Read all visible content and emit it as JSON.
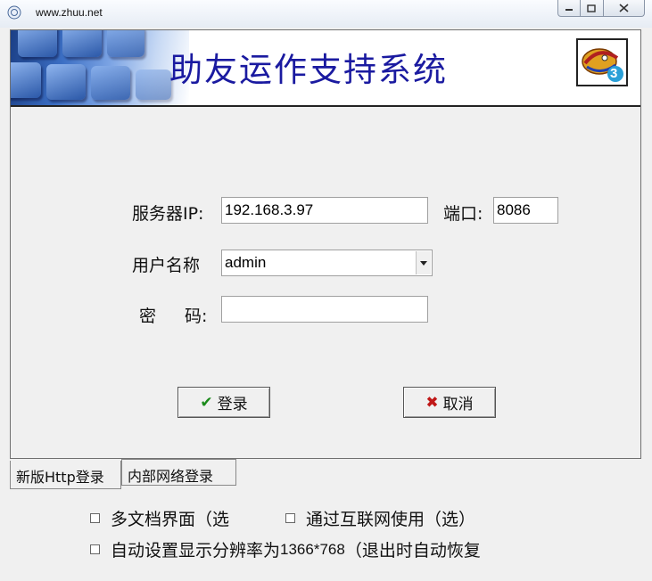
{
  "window": {
    "title": "www.zhuu.net",
    "minimize_label": "▭",
    "restore_label": "⧉",
    "close_label": "✕"
  },
  "banner": {
    "title": "助友运作支持系统",
    "logo_icon": "logo-badge-icon",
    "logo_badge": "3"
  },
  "form": {
    "server_label": "服务器IP:",
    "server_value": "192.168.3.97",
    "port_label": "端口:",
    "port_value": "8086",
    "user_label": "用户名称",
    "user_value": "admin",
    "password_label_1": "密",
    "password_label_2": "码:",
    "password_value": ""
  },
  "buttons": {
    "login_label": "登录",
    "login_icon": "✔",
    "cancel_label": "取消",
    "cancel_icon": "✖"
  },
  "tabs": [
    {
      "label": "新版Http登录",
      "active": true
    },
    {
      "label": "内部网络登录",
      "active": false
    }
  ],
  "options": {
    "multi_doc": "多文档界面（选",
    "internet": "通过互联网使用（选）",
    "auto_res": "自动设置显示分辨率为",
    "auto_res_num": "1366*768",
    "auto_res_suffix": "（退出时自动恢复"
  },
  "colors": {
    "title_blue": "#1a1aa0",
    "check_green": "#1b8a1b",
    "cross_red": "#c01818"
  }
}
